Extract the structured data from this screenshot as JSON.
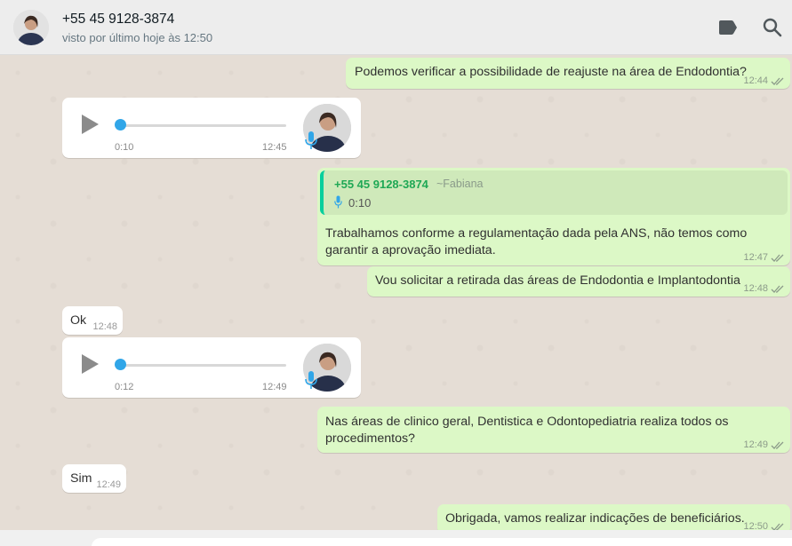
{
  "header": {
    "contact_name": "+55 45 9128-3874",
    "status": "visto por último hoje às 12:50",
    "icons": [
      "label-icon",
      "search-icon"
    ]
  },
  "messages": [
    {
      "direction": "out",
      "text": "Podemos verificar a possibilidade de reajuste na área de Endodontia?",
      "time": "12:44"
    },
    {
      "direction": "in",
      "type": "voice",
      "duration": "0:10",
      "time": "12:45"
    },
    {
      "direction": "out",
      "quote": {
        "author": "+55 45 9128-3874",
        "alias": "~Fabiana",
        "duration": "0:10"
      },
      "text_line1": "Trabalhamos conforme a regulamentação dada pela ANS, não temos como",
      "text_line2": "garantir a aprovação imediata.",
      "time": "12:47"
    },
    {
      "direction": "out",
      "text": "Vou solicitar a retirada das áreas de Endodontia e Implantodontia",
      "time": "12:48"
    },
    {
      "direction": "in",
      "text": "Ok",
      "time": "12:48"
    },
    {
      "direction": "in",
      "type": "voice",
      "duration": "0:12",
      "time": "12:49"
    },
    {
      "direction": "out",
      "text_line1": "Nas áreas de clinico geral, Dentistica e Odontopediatria realiza todos os",
      "text_line2": "procedimentos?",
      "time": "12:49"
    },
    {
      "direction": "in",
      "text": "Sim",
      "time": "12:49"
    },
    {
      "direction": "out",
      "text": "Obrigada, vamos realizar indicações de beneficiários.",
      "time": "12:50"
    }
  ]
}
